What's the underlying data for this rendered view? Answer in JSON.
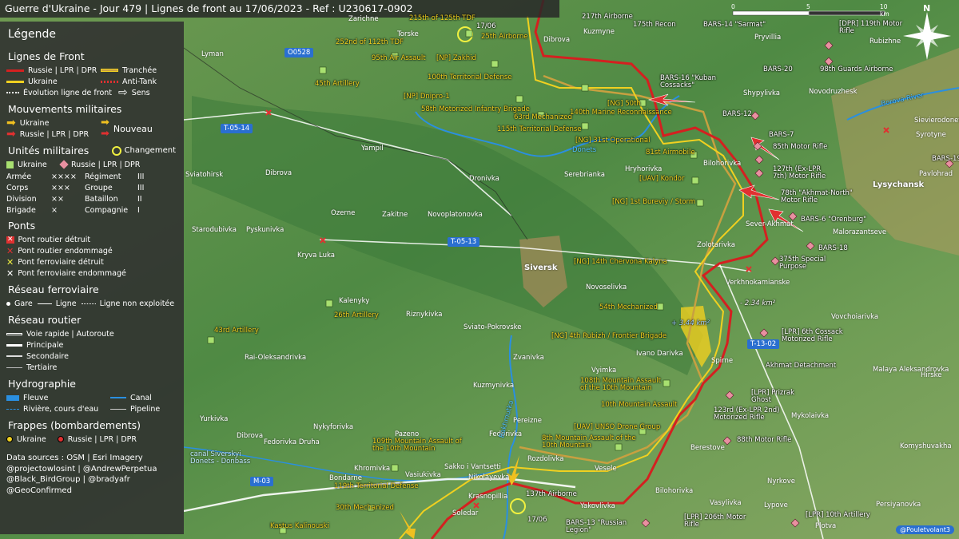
{
  "title": "Guerre d'Ukraine - Jour 479 | Lignes de front au 17/06/2023 - Ref : U230617-0902",
  "legend": {
    "title": "Légende",
    "front": {
      "heading": "Lignes de Front",
      "russia": "Russie | LPR | DPR",
      "trench": "Tranchée",
      "ukraine": "Ukraine",
      "antitank": "Anti-Tank",
      "evolution": "Évolution ligne de front",
      "direction": "Sens"
    },
    "movements": {
      "heading": "Mouvements militaires",
      "ukraine": "Ukraine",
      "russia": "Russie | LPR | DPR",
      "new": "Nouveau"
    },
    "units": {
      "heading": "Unités militaires",
      "change": "Changement",
      "ukraine": "Ukraine",
      "russia": "Russie | LPR | DPR",
      "sizes": [
        {
          "a": "Armée",
          "as": "××××",
          "b": "Régiment",
          "bs": "III"
        },
        {
          "a": "Corps",
          "as": "×××",
          "b": "Groupe",
          "bs": "III"
        },
        {
          "a": "Division",
          "as": "××",
          "b": "Bataillon",
          "bs": "II"
        },
        {
          "a": "Brigade",
          "as": "×",
          "b": "Compagnie",
          "bs": "I"
        }
      ]
    },
    "bridges": {
      "heading": "Ponts",
      "items": [
        "Pont routier détruit",
        "Pont routier endommagé",
        "Pont ferroviaire détruit",
        "Pont ferroviaire endommagé"
      ]
    },
    "rail": {
      "heading": "Réseau ferroviaire",
      "station": "Gare",
      "line": "Ligne",
      "unused": "Ligne non exploitée"
    },
    "roads": {
      "heading": "Réseau routier",
      "items": [
        "Voie rapide | Autoroute",
        "Principale",
        "Secondaire",
        "Tertiaire"
      ]
    },
    "hydro": {
      "heading": "Hydrographie",
      "river_big": "Fleuve",
      "canal": "Canal",
      "river": "Rivière, cours d'eau",
      "pipeline": "Pipeline"
    },
    "strikes": {
      "heading": "Frappes (bombardements)",
      "ukraine": "Ukraine",
      "russia": "Russie | LPR | DPR"
    },
    "sources": [
      "Data sources : OSM | Esri Imagery",
      "@projectowlosint | @AndrewPerpetua",
      "@Black_BirdGroup | @bradyafr",
      "@GeoConfirmed"
    ]
  },
  "colors": {
    "russia": "#d42020",
    "ukraine": "#f0d020",
    "trench": "#c8a040",
    "ua_unit": "#a8e070",
    "ru_unit": "#e890a0",
    "water": "#2a8fe0"
  },
  "scale": {
    "labels": [
      "0",
      "5",
      "10 km"
    ]
  },
  "north": "N",
  "credit": "@Pouletvolant3",
  "badges": [
    {
      "id": "O0528",
      "label": "O0528"
    },
    {
      "id": "T-05-14",
      "label": "T-05-14"
    },
    {
      "id": "T-05-13",
      "label": "T-05-13"
    },
    {
      "id": "T-13-02",
      "label": "T-13-02"
    },
    {
      "id": "M-03",
      "label": "M-03"
    }
  ],
  "towns": [
    "Zarichne",
    "Torske",
    "Lyman",
    "Dibrova",
    "Kuzmyne",
    "Yampil",
    "Dibrova",
    "Dronivka",
    "Serebrianka",
    "Hryhorivka",
    "Bilohorivka",
    "Sviatohirsk",
    "Siversk",
    "Zakitne",
    "Novoplatonovka",
    "Ozerne",
    "Starodubivka",
    "Pyskunivka",
    "Kryva Luka",
    "Kalenyky",
    "Riznykivka",
    "Sviato-Pokrovske",
    "Rai-Oleksandrivka",
    "Zvanivka",
    "Kuzmynivka",
    "Vyimka",
    "Ivano Darivka",
    "Spirne",
    "Verkhnokamianske",
    "Novoselivka",
    "Zolotarivka",
    "Pereizne",
    "Fedorivka",
    "Rozdolivka",
    "Yurkivka",
    "Pazeno",
    "Nykyforivka",
    "Fedorivka Druha",
    "Dibrova",
    "Bondarne",
    "Khromivka",
    "Vasiukivka",
    "Sakko i Vantsetti",
    "Nikolayevka",
    "Krasnopillia",
    "Soledar",
    "Yakovlivka",
    "Vesele",
    "Berestove",
    "Bilohorivka",
    "Pryvillia",
    "Rubizhne",
    "Shypylivka",
    "Novodruzhesk",
    "Lysychansk",
    "Sievierodonetsk",
    "Syrotyne",
    "Pavlohrad",
    "Sever-Akhmat",
    "Malorazantseve",
    "Vovchoiarivka",
    "Malaya Aleksandrovka",
    "Hirske",
    "Mykolaivka",
    "Nyrkove",
    "Lypove",
    "Vasylivka",
    "Persiyanovka",
    "Komyshuvakha",
    "Plotva"
  ],
  "ua_units": [
    "215th of 125th TDF",
    "25th Airborne",
    "252nd of 112th TDF",
    "95th Air Assault",
    "[NP] Zakhid",
    "100th Territorial Defense",
    "45th Artillery",
    "[NP] Dnipro-1",
    "58th Motorized Infantry Brigade",
    "63rd Mechanized",
    "[NG] 50th",
    "140th Marine Reconnaissance",
    "115th Territorial Defense",
    "[NG] 31st Operational",
    "81st Airmobile",
    "[UAV] Kondor",
    "[NG] 1st Bureviy / Storm",
    "[NG] 14th Chervona Kalyna",
    "54th Mechanized",
    "26th Artillery",
    "43rd Artillery",
    "[NG] 4th Rubizh / Frontier Brigade",
    "108th Mountain Assault of the 10th Mountain",
    "10th Mountain Assault",
    "[UAV] UNSO Drone Group",
    "8th Mountain Assault of the 10th Mountain",
    "109th Mountain Assault of the 10th Mountain",
    "119th Territorial Defense",
    "30th Mechanized",
    "Kastus Kalinouski"
  ],
  "ru_units": [
    "217th Airborne",
    "175th Recon",
    "BARS-14 \"Sarmat\"",
    "[DPR] 119th Motor Rifle",
    "BARS-20",
    "98th Guards Airborne",
    "BARS-16 \"Kuban Cossacks\"",
    "BARS-12",
    "BARS-7",
    "85th Motor Rifle",
    "127th (Ex-LPR 7th) Motor Rifle",
    "78th \"Akhmat-North\" Motor Rifle",
    "BARS-6 \"Orenburg\"",
    "BARS-19",
    "BARS-18",
    "375th Special Purpose",
    "[LPR] 6th Cossack Motorized Rifle",
    "Akhmat Detachment",
    "[LPR] Prizrak Ghost",
    "123rd (Ex-LPR 2nd) Motorized Rifle",
    "88th Motor Rifle",
    "137th Airborne",
    "BARS-13 \"Russian Legion\"",
    "[LPR] 206th Motor Rifle",
    "[LPR] 10th Artillery"
  ],
  "annotations": {
    "a1": "- 2.34 km²",
    "a2": "+ 3.44 km²",
    "d1": "17/06",
    "d2": "17/06"
  },
  "rivers": {
    "r1": "Borova River",
    "r2": "Donets",
    "r3": "Bakhmutka",
    "r4": "canal Siverskyi Donets - Donbass"
  }
}
